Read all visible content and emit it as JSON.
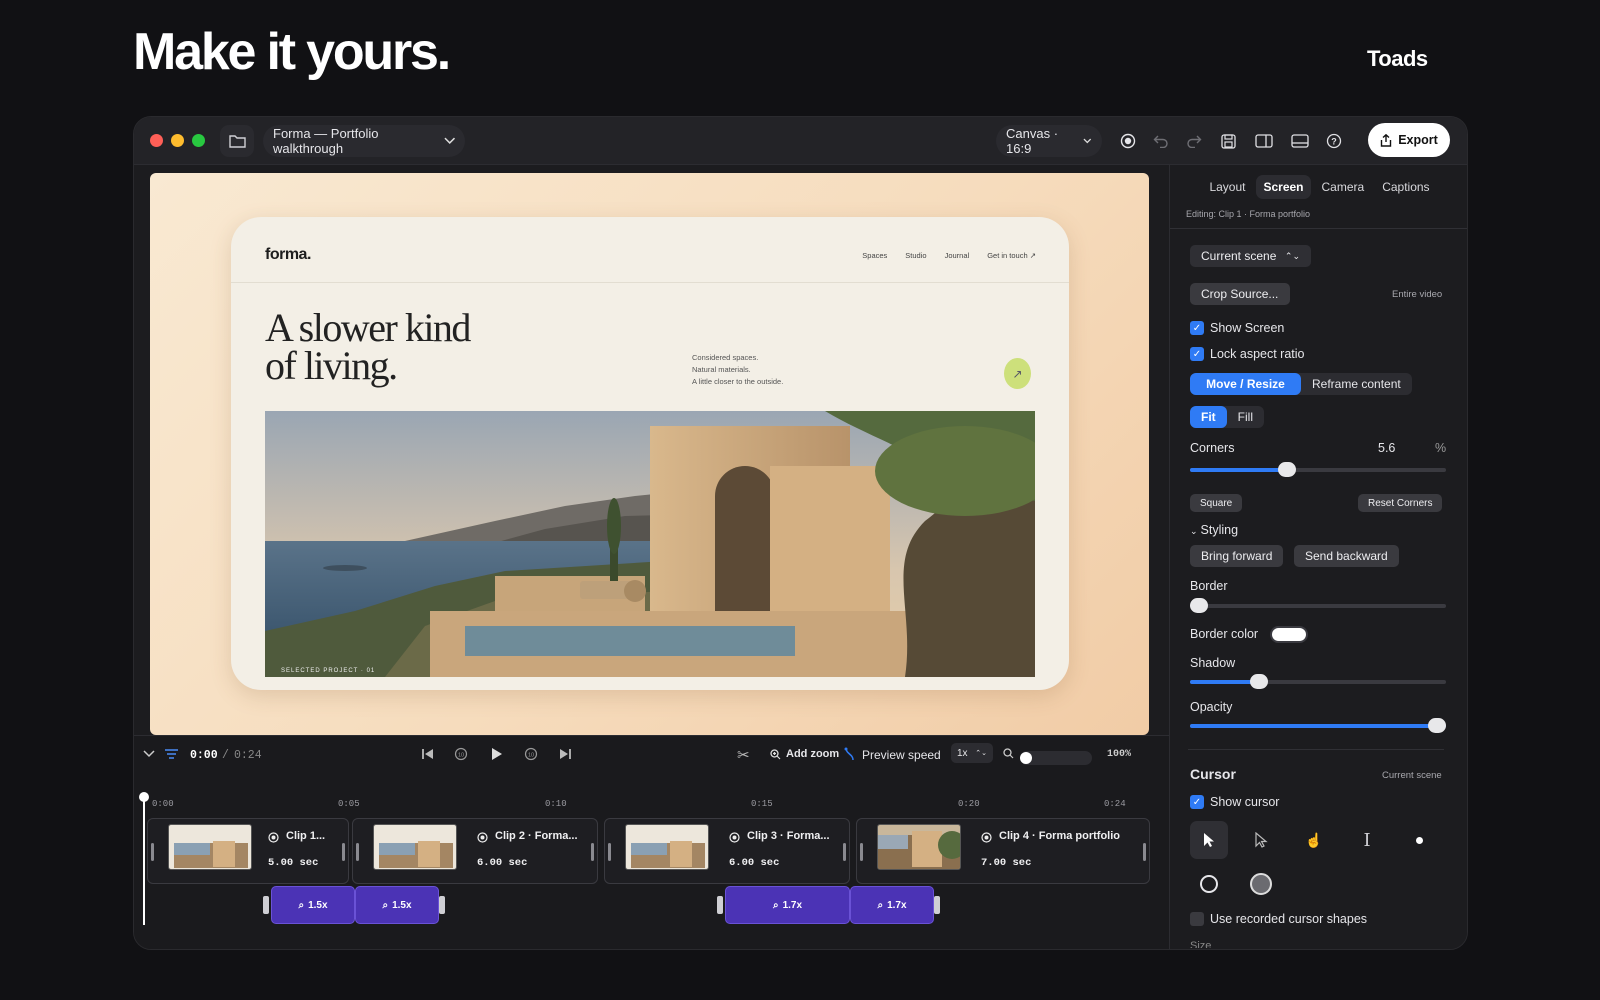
{
  "hero": {
    "title": "Make it yours.",
    "brand": "Toads"
  },
  "titlebar": {
    "project": "Forma — Portfolio walkthrough",
    "canvas": "Canvas · 16:9",
    "export": "Export"
  },
  "preview": {
    "logo": "forma.",
    "nav": [
      "Spaces",
      "Studio",
      "Journal",
      "Get in touch ↗"
    ],
    "headline_1": "A slower kind",
    "headline_2": "of living.",
    "blurb": [
      "Considered spaces.",
      "Natural materials.",
      "A little closer to the outside."
    ],
    "photo_caption": "SELECTED PROJECT · 01"
  },
  "panel": {
    "tabs": [
      "Layout",
      "Screen",
      "Camera",
      "Captions"
    ],
    "active_tab": "Screen",
    "editing": "Editing: Clip 1 · Forma portfolio",
    "scope_select": "Current scene",
    "crop_button": "Crop Source...",
    "crop_scope": "Entire video",
    "show_screen": "Show Screen",
    "lock_aspect": "Lock aspect ratio",
    "mode_seg": [
      "Move / Resize",
      "Reframe content"
    ],
    "fit_seg": [
      "Fit",
      "Fill"
    ],
    "corners_label": "Corners",
    "corners_value": "5.6",
    "corners_unit": "%",
    "corners_level": 0.38,
    "square_btn": "Square",
    "reset_corners_btn": "Reset Corners",
    "styling_label": "Styling",
    "bring_forward": "Bring forward",
    "send_backward": "Send backward",
    "border_label": "Border",
    "border_level": 0.0,
    "border_color_label": "Border color",
    "border_color": "#ffffff",
    "shadow_label": "Shadow",
    "shadow_level": 0.27,
    "opacity_label": "Opacity",
    "opacity_level": 1.0,
    "cursor_heading": "Cursor",
    "cursor_scope": "Current scene",
    "show_cursor": "Show cursor",
    "use_recorded": "Use recorded cursor shapes",
    "size_label": "Size"
  },
  "timeline": {
    "current_time": "0:00",
    "separator": "/",
    "total_time": "0:24",
    "add_zoom": "Add zoom",
    "preview_speed": "Preview speed",
    "speed_value": "1x",
    "zoom_percent": "100%",
    "ruler": [
      "0:00",
      "0:05",
      "0:10",
      "0:15",
      "0:20",
      "0:24"
    ],
    "clips": [
      {
        "title": "Clip 1...",
        "duration": "5.00 sec"
      },
      {
        "title": "Clip 2 · Forma...",
        "duration": "6.00 sec"
      },
      {
        "title": "Clip 3 · Forma...",
        "duration": "6.00 sec"
      },
      {
        "title": "Clip 4 · Forma portfolio",
        "duration": "7.00 sec"
      }
    ],
    "zooms": [
      "1.5x",
      "1.5x",
      "1.7x",
      "1.7x"
    ]
  },
  "colors": {
    "accent": "#2f7bf5",
    "zoom": "#4b33b5",
    "background": "#111114"
  }
}
